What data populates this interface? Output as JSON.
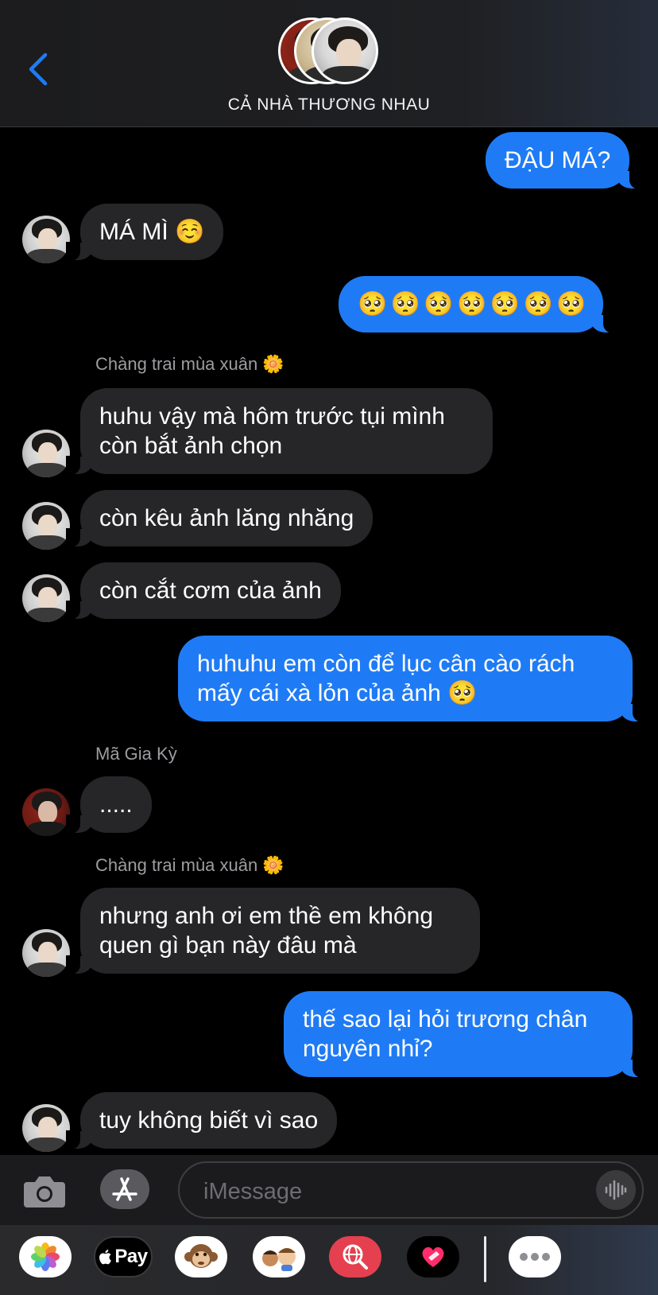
{
  "header": {
    "group_name": "CẢ NHÀ THƯƠNG NHAU",
    "back_icon": "chevron-left-icon"
  },
  "colors": {
    "incoming_bubble": "#262628",
    "outgoing_bubble": "#1f7bf5",
    "accent": "#1f7bf5",
    "sender_label": "#9d9da2"
  },
  "messages": [
    {
      "direction": "out",
      "text": "ĐẬU MÁ?"
    },
    {
      "direction": "in",
      "sender_avatar": "chang-trai",
      "text": "MÁ MÌ ☺️"
    },
    {
      "direction": "out",
      "text": "🥺 🥺 🥺 🥺 🥺 🥺 🥺"
    },
    {
      "direction": "in",
      "sender_name": "Chàng trai mùa xuân 🌼",
      "text": "huhu vậy mà hôm trước tụi mình\ncòn bắt ảnh chọn"
    },
    {
      "direction": "in",
      "text": "còn kêu ảnh lăng nhăng"
    },
    {
      "direction": "in",
      "text": "còn cắt cơm của ảnh"
    },
    {
      "direction": "out",
      "text": "huhuhu em còn để lục cân cào rách\nmấy cái xà lỏn của ảnh 🥺"
    },
    {
      "direction": "in",
      "sender_name": "Mã Gia Kỳ",
      "text": "....."
    },
    {
      "direction": "in",
      "sender_name": "Chàng trai mùa xuân 🌼",
      "text": "nhưng anh ơi em thề em không\nquen gì bạn này đâu mà"
    },
    {
      "direction": "out",
      "text": "thế sao lại hỏi trương chân\nnguyên nhỉ?"
    },
    {
      "direction": "in",
      "text": "tuy không biết vì sao"
    }
  ],
  "composer": {
    "placeholder": "iMessage",
    "camera_icon": "camera-icon",
    "appstore_icon": "app-store-icon",
    "audio_icon": "audio-waveform-icon"
  },
  "app_drawer": [
    {
      "name": "photos-app",
      "icon": "photos-icon"
    },
    {
      "name": "apple-pay-app",
      "label": "Pay",
      "icon": "apple-logo-icon"
    },
    {
      "name": "animoji-app",
      "icon": "monkey-icon"
    },
    {
      "name": "memoji-app",
      "icon": "memoji-icon"
    },
    {
      "name": "image-search-app",
      "icon": "globe-search-icon"
    },
    {
      "name": "digital-touch-app",
      "icon": "heart-hand-icon"
    },
    {
      "name": "more-apps",
      "icon": "ellipsis-icon"
    }
  ]
}
